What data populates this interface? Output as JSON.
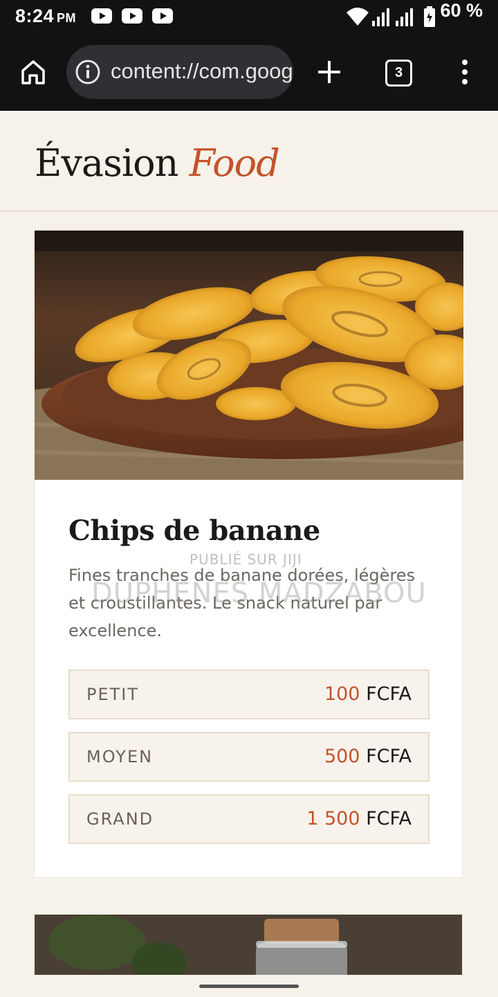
{
  "status_bar": {
    "time": "8:24",
    "ampm": "PM",
    "notification_icons": [
      "youtube-icon",
      "youtube-icon",
      "youtube-icon"
    ],
    "battery_percent": "60 %"
  },
  "browser": {
    "url": "content://com.google.android",
    "tab_count": "3"
  },
  "site": {
    "brand_main": "Évasion ",
    "brand_accent": "Food"
  },
  "product": {
    "title": "Chips de banane",
    "description": "Fines tranches de banane dorées, légères et croustillantes. Le snack naturel par excellence.",
    "prices": [
      {
        "size": "PETIT",
        "amount": "100",
        "currency": " FCFA"
      },
      {
        "size": "MOYEN",
        "amount": "500",
        "currency": " FCFA"
      },
      {
        "size": "GRAND",
        "amount": "1 500",
        "currency": " FCFA"
      }
    ]
  },
  "watermark": {
    "line1": "PUBLIÉ SUR JIJI",
    "line2": "DUPHENES MADZABOU"
  },
  "colors": {
    "accent": "#c4532a",
    "page_bg": "#f6f2ea",
    "toolbar_bg": "#121212"
  }
}
